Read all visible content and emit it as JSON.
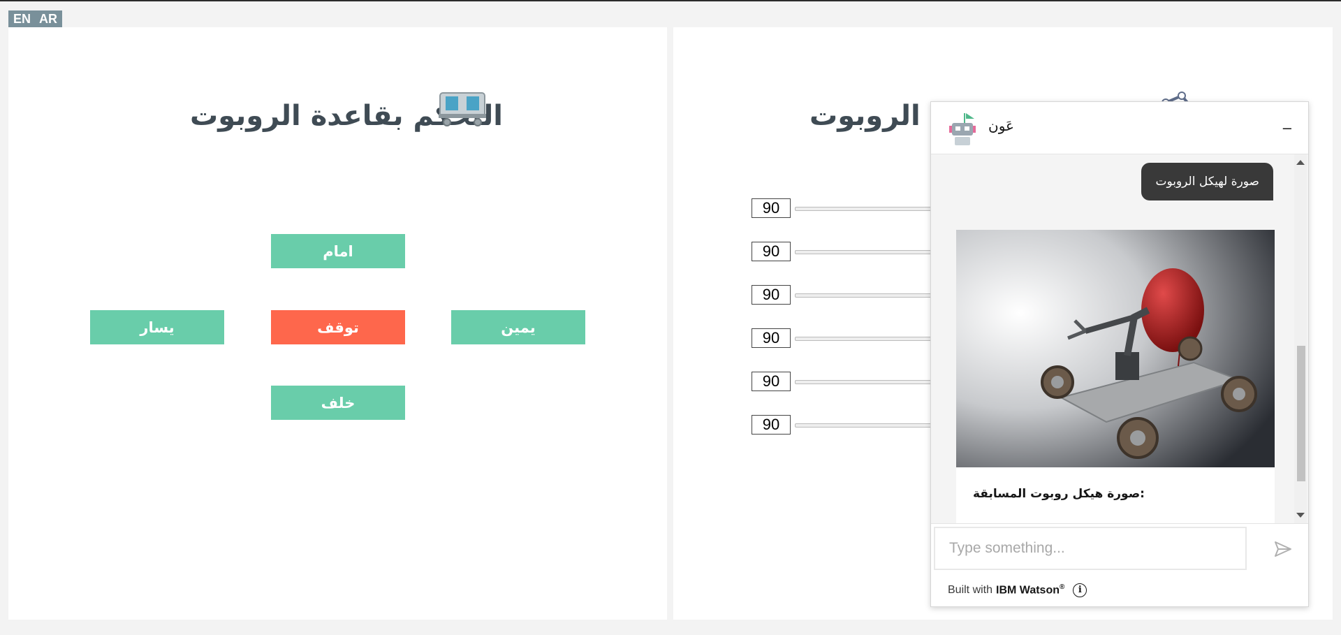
{
  "lang": {
    "en": "EN",
    "ar": "AR"
  },
  "base_panel": {
    "title": "التحكم بقاعدة الروبوت",
    "buttons": {
      "forward": "امام",
      "left": "يسار",
      "stop": "توقف",
      "right": "يمين",
      "back": "خلف"
    }
  },
  "arm_panel": {
    "title_visible": "ع الروبوت",
    "sliders": [
      {
        "value": "90"
      },
      {
        "value": "90"
      },
      {
        "value": "90"
      },
      {
        "value": "90"
      },
      {
        "value": "90"
      },
      {
        "value": "90"
      }
    ]
  },
  "chat": {
    "bot_name": "عَون",
    "minimize": "–",
    "user_message": "صورة لهيكل الروبوت",
    "card_caption": "صورة هيكل روبوت المسابقة:",
    "help": "?",
    "input_placeholder": "Type something...",
    "footer": {
      "built_with": "Built with",
      "brand": "IBM Watson",
      "reg": "®",
      "info": "i"
    }
  },
  "colors": {
    "green": "#69cdaa",
    "red": "#fe674c",
    "title": "#3f4b54",
    "bubble": "#393939"
  }
}
